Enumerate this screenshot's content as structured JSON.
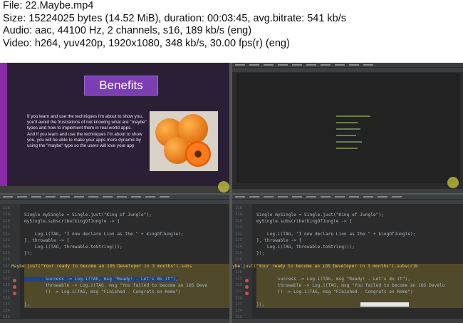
{
  "info": {
    "line1": "File: 22.Maybe.mp4",
    "line2": "Size: 15224025 bytes (14.52 MiB), duration: 00:03:45, avg.bitrate: 541 kb/s",
    "line3": "Audio: aac, 44100 Hz, 2 channels, s16, 189 kb/s (eng)",
    "line4": "Video: h264, yuv420p, 1920x1080, 348 kb/s, 30.00 fps(r) (eng)"
  },
  "slide": {
    "title": "Benefits",
    "bullet1": "If you learn and use the techniques I'm about to show you, you'll avoid the frustrations of not knowing what are \"maybe\" types and how to implement them in real world apps.",
    "bullet2": "And if you learn and use the techniques I'm about to show you, you will be able to make your apps more dynamic by using the \"maybe\" type so the users will love your app"
  },
  "code_left": {
    "line_numbers": [
      "118",
      "119",
      "120",
      "121",
      "122",
      "123",
      "124",
      "125",
      "126",
      "127",
      "128",
      "129",
      "130",
      "131",
      "132",
      "133",
      "134",
      "135"
    ],
    "l1": "Single mySingle = Single.just(\"King of Jungle\");",
    "l2": "mySingle.subscribe(kingOfJungle -> {",
    "l3": "    Log.i(TAG, \"I now declare Lion as the \" + kingOfJungle);",
    "l4": "}, throwable -> {",
    "l5": "    Log.i(TAG, throwable.toString());",
    "l6": "});",
    "l7": "Maybe.just(\"Your ready to become an iOS Developer in 3 months\").subs",
    "l8": "        success -> Log.i(TAG, msg \"Ready! - Let's do it\"),",
    "l9": "        throwable -> Log.i(TAG, msg \"You failed to become an iOS Deve",
    "l10": "        () -> Log.i(TAG, msg \"Finished - Congrats on Rome\")",
    "l11": "};"
  },
  "code_right": {
    "line_numbers": [
      "118",
      "119",
      "120",
      "121",
      "122",
      "123",
      "124",
      "125",
      "126",
      "127",
      "128",
      "129",
      "130",
      "131",
      "132",
      "133",
      "134",
      "135"
    ],
    "l1": "Single mySingle = Single.just(\"King of Jungle\");",
    "l2": "mySingle.subscribe(kingOfJungle -> {",
    "l3": "    Log.i(TAG, \"I now declare Lion as the \" + kingOfJungle);",
    "l4": "}, throwable -> {",
    "l5": "    Log.i(TAG, throwable.toString());",
    "l6": "});",
    "l7": "ybe.just(\"Your ready to become an iOS Developer in 3 months\").subscrib",
    "l8": "        success -> Log.i(TAG, msg \"Ready! - Let's do it\"),",
    "l9": "        throwable -> Log.i(TAG, msg \"You failed to become an iOS Develo",
    "l10": "        () -> Log.i(TAG, msg \"Finished - Congrats on Rome\")",
    "l11": "});"
  },
  "colors": {
    "slide_bg": "#2b1f36",
    "slide_accent": "#8a2aa8",
    "ide_bg": "#2b2b2b",
    "highlight": "#514a2a"
  }
}
